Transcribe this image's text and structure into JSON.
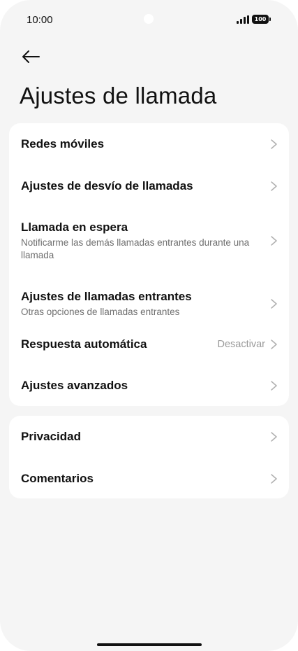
{
  "status_bar": {
    "time": "10:00",
    "battery": "100"
  },
  "header": {
    "title": "Ajustes de llamada"
  },
  "group1": [
    {
      "title": "Redes móviles"
    },
    {
      "title": "Ajustes de desvío de llamadas"
    },
    {
      "title": "Llamada en espera",
      "subtitle": "Notificarme las demás llamadas entrantes durante una llamada"
    },
    {
      "title": "Ajustes de llamadas entrantes",
      "subtitle": "Otras opciones de llamadas entrantes"
    },
    {
      "title": "Respuesta automática",
      "value": "Desactivar"
    },
    {
      "title": "Ajustes avanzados"
    }
  ],
  "group2": [
    {
      "title": "Privacidad"
    },
    {
      "title": "Comentarios"
    }
  ],
  "colors": {
    "background": "#f5f5f5",
    "card": "#ffffff",
    "text": "#111111",
    "secondary_text": "#6f6f6f",
    "chevron": "#b0b0b0"
  },
  "icons": {
    "back": "arrow-left-icon",
    "chevron": "chevron-right-icon",
    "signal": "signal-icon",
    "battery": "battery-icon"
  }
}
